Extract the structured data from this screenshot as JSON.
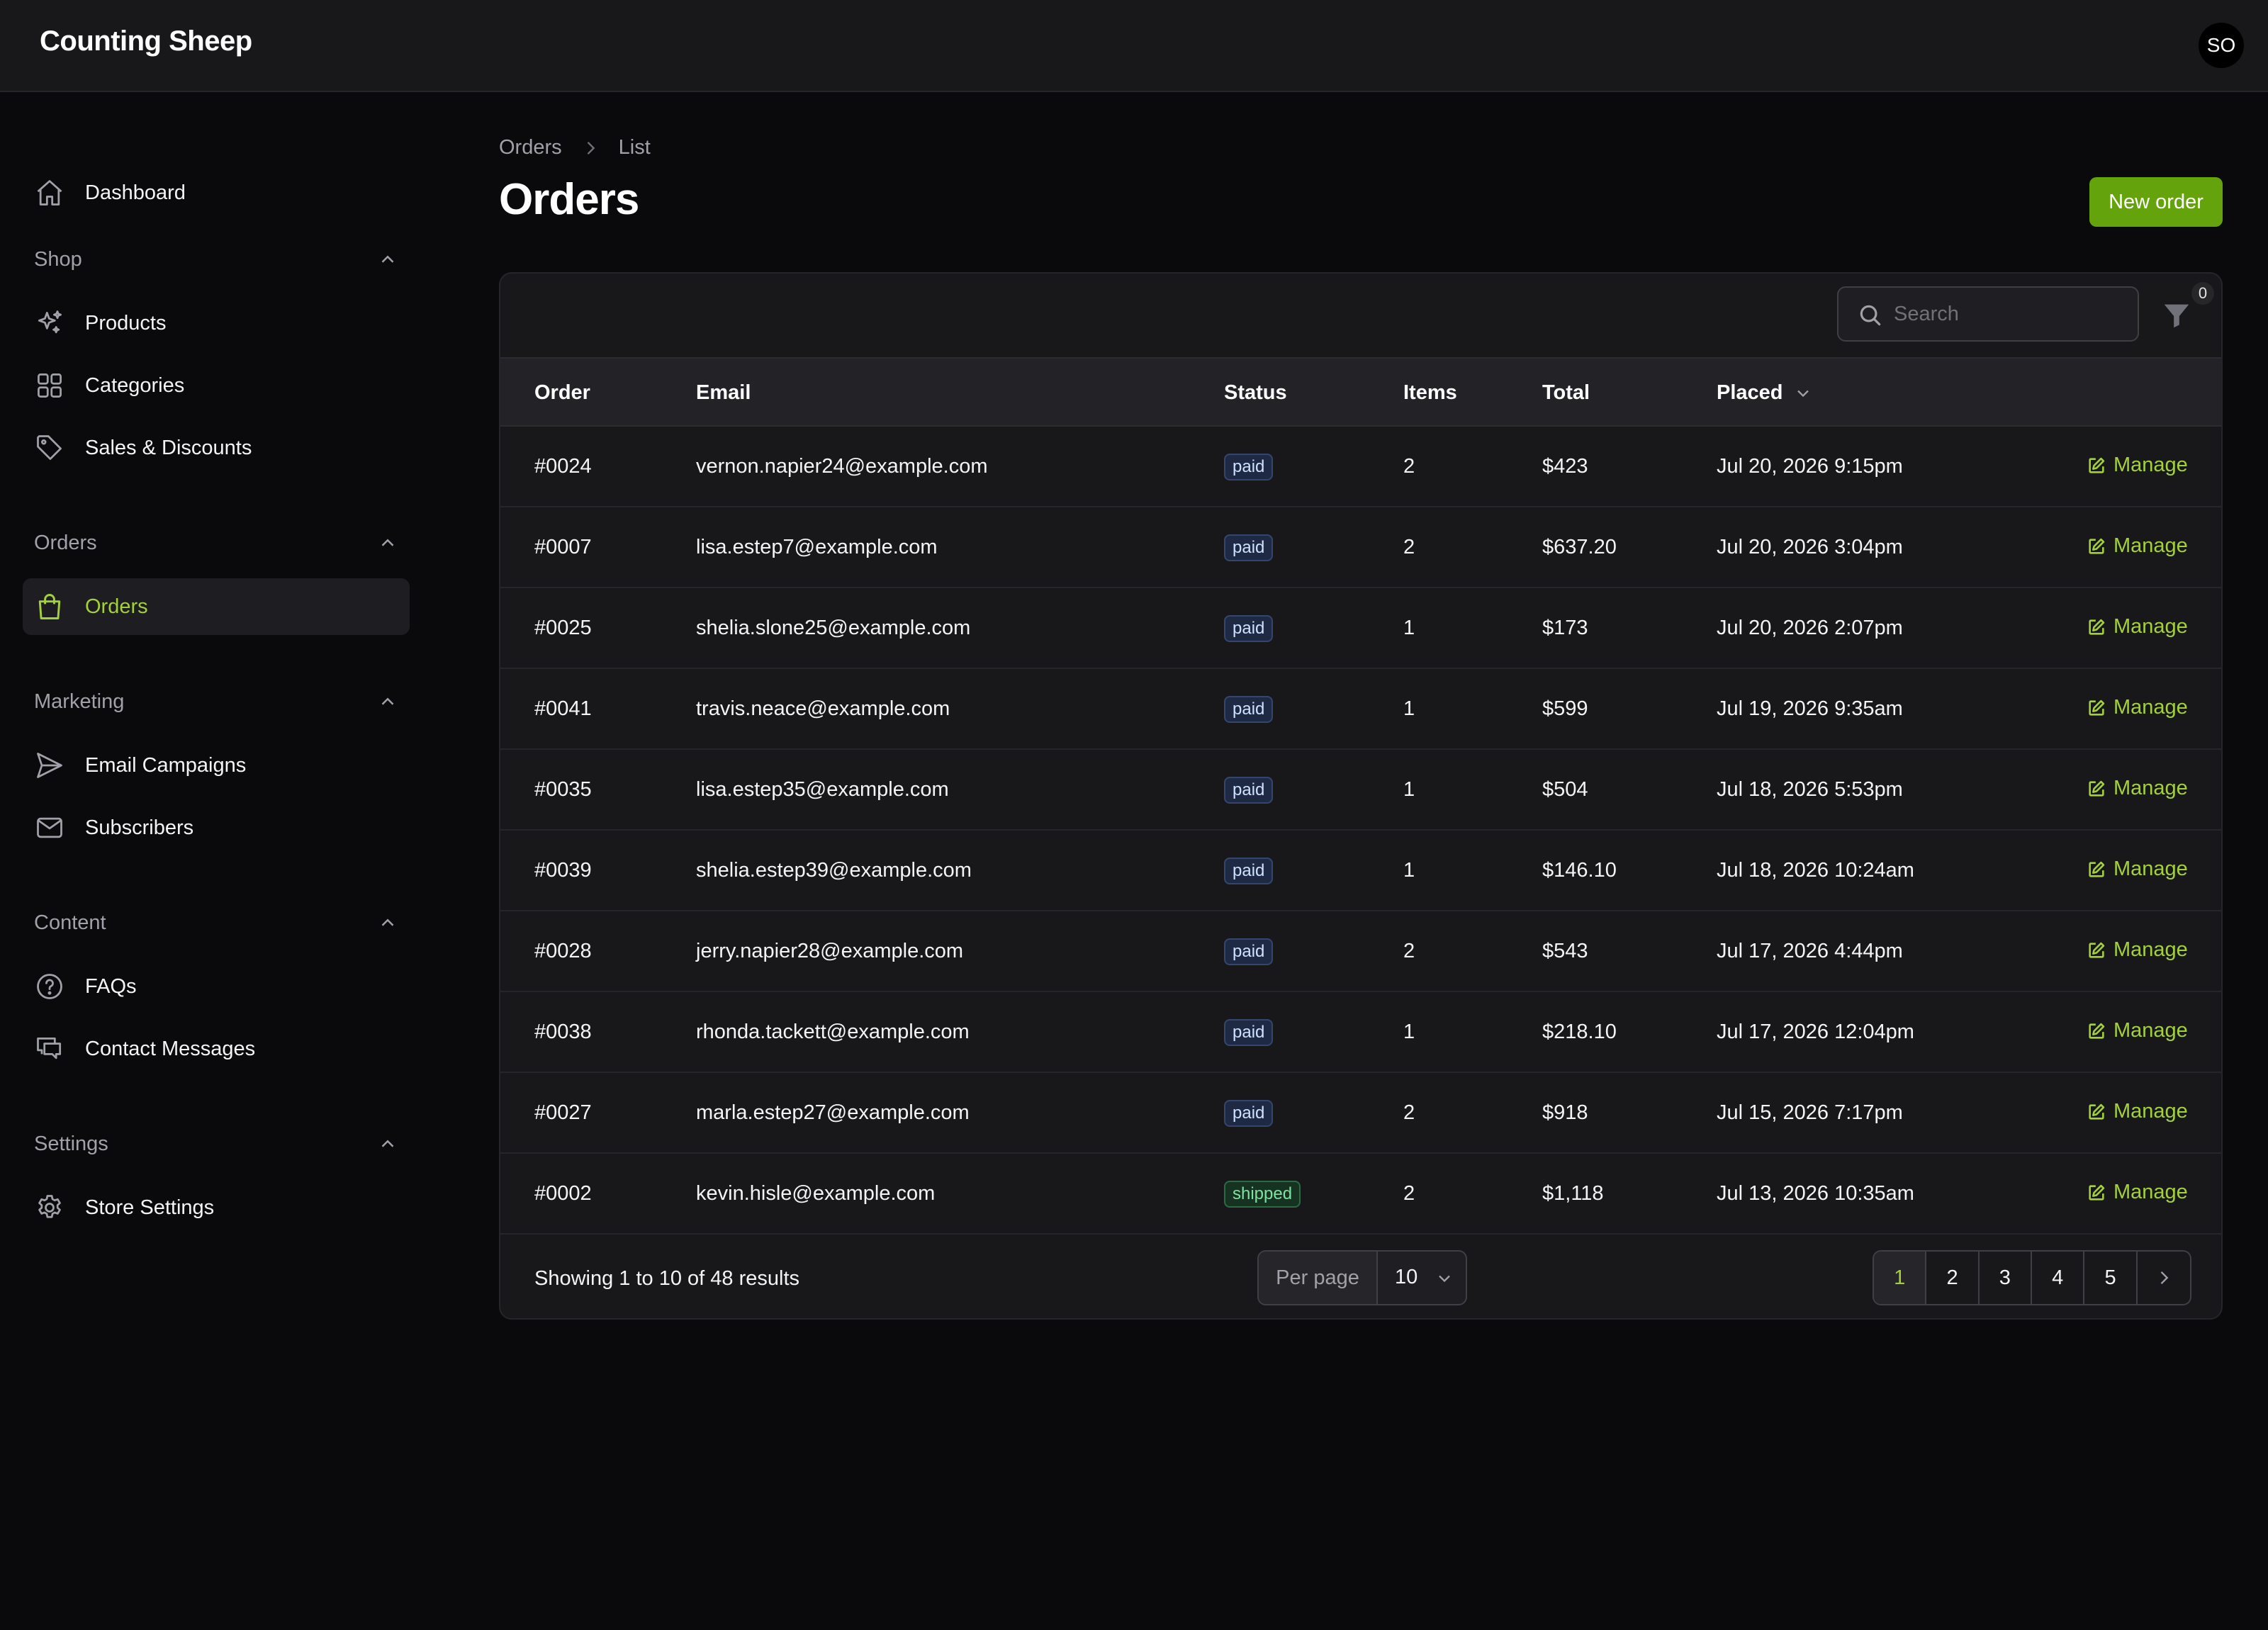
{
  "app": {
    "brand": "Counting Sheep",
    "user_initials": "SO"
  },
  "sidebar": {
    "dashboard": {
      "label": "Dashboard",
      "icon": "home-icon"
    },
    "sections": [
      {
        "title": "Shop",
        "items": [
          {
            "label": "Products",
            "icon": "sparkles-icon"
          },
          {
            "label": "Categories",
            "icon": "grid-icon"
          },
          {
            "label": "Sales & Discounts",
            "icon": "tag-icon"
          }
        ]
      },
      {
        "title": "Orders",
        "items": [
          {
            "label": "Orders",
            "icon": "shopping-bag-icon",
            "active": true
          }
        ]
      },
      {
        "title": "Marketing",
        "items": [
          {
            "label": "Email Campaigns",
            "icon": "paper-plane-icon"
          },
          {
            "label": "Subscribers",
            "icon": "envelope-icon"
          }
        ]
      },
      {
        "title": "Content",
        "items": [
          {
            "label": "FAQs",
            "icon": "question-circle-icon"
          },
          {
            "label": "Contact Messages",
            "icon": "chat-bubbles-icon"
          }
        ]
      },
      {
        "title": "Settings",
        "items": [
          {
            "label": "Store Settings",
            "icon": "gear-icon"
          }
        ]
      }
    ]
  },
  "header": {
    "breadcrumb": [
      "Orders",
      "List"
    ],
    "title": "Orders",
    "new_button": "New order"
  },
  "toolbar": {
    "search_placeholder": "Search",
    "filter_count": "0"
  },
  "table": {
    "columns": {
      "order": "Order",
      "email": "Email",
      "status": "Status",
      "items": "Items",
      "total": "Total",
      "placed": "Placed"
    },
    "manage_label": "Manage",
    "rows": [
      {
        "order": "#0024",
        "email": "vernon.napier24@example.com",
        "status": "paid",
        "items": "2",
        "total": "$423",
        "placed": "Jul 20, 2026 9:15pm"
      },
      {
        "order": "#0007",
        "email": "lisa.estep7@example.com",
        "status": "paid",
        "items": "2",
        "total": "$637.20",
        "placed": "Jul 20, 2026 3:04pm"
      },
      {
        "order": "#0025",
        "email": "shelia.slone25@example.com",
        "status": "paid",
        "items": "1",
        "total": "$173",
        "placed": "Jul 20, 2026 2:07pm"
      },
      {
        "order": "#0041",
        "email": "travis.neace@example.com",
        "status": "paid",
        "items": "1",
        "total": "$599",
        "placed": "Jul 19, 2026 9:35am"
      },
      {
        "order": "#0035",
        "email": "lisa.estep35@example.com",
        "status": "paid",
        "items": "1",
        "total": "$504",
        "placed": "Jul 18, 2026 5:53pm"
      },
      {
        "order": "#0039",
        "email": "shelia.estep39@example.com",
        "status": "paid",
        "items": "1",
        "total": "$146.10",
        "placed": "Jul 18, 2026 10:24am"
      },
      {
        "order": "#0028",
        "email": "jerry.napier28@example.com",
        "status": "paid",
        "items": "2",
        "total": "$543",
        "placed": "Jul 17, 2026 4:44pm"
      },
      {
        "order": "#0038",
        "email": "rhonda.tackett@example.com",
        "status": "paid",
        "items": "1",
        "total": "$218.10",
        "placed": "Jul 17, 2026 12:04pm"
      },
      {
        "order": "#0027",
        "email": "marla.estep27@example.com",
        "status": "paid",
        "items": "2",
        "total": "$918",
        "placed": "Jul 15, 2026 7:17pm"
      },
      {
        "order": "#0002",
        "email": "kevin.hisle@example.com",
        "status": "shipped",
        "items": "2",
        "total": "$1,118",
        "placed": "Jul 13, 2026 10:35am"
      }
    ]
  },
  "footer": {
    "summary": "Showing 1 to 10 of 48 results",
    "per_page_label": "Per page",
    "per_page_value": "10",
    "pages": [
      "1",
      "2",
      "3",
      "4",
      "5"
    ],
    "current_page": "1"
  },
  "colors": {
    "accent": "#a3d13a",
    "button": "#65a30d",
    "background": "#0a0a0c",
    "surface": "#18181b"
  }
}
